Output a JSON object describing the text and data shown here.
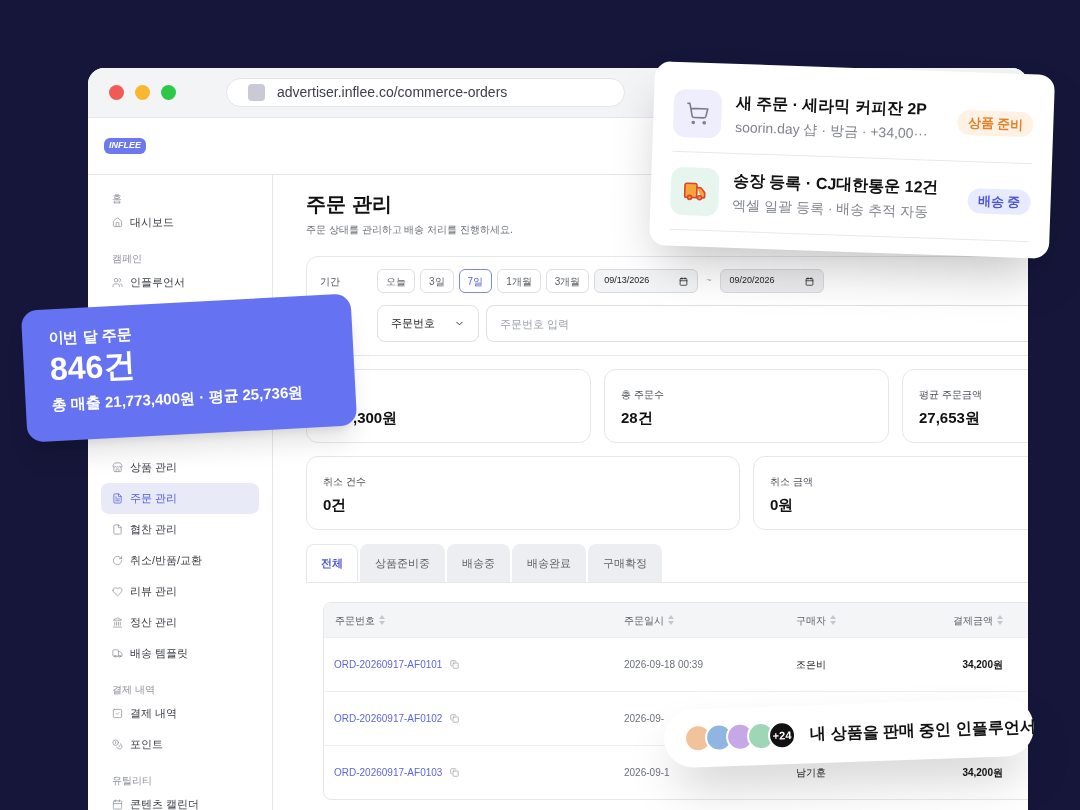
{
  "browser": {
    "url": "advertiser.inflee.co/commerce-orders"
  },
  "logo": "INFLEE",
  "sidebar": [
    {
      "heading": "홈",
      "items": [
        {
          "label": "대시보드",
          "selected": false
        }
      ]
    },
    {
      "heading": "캠페인",
      "items": [
        {
          "label": "인플루언서",
          "selected": false
        }
      ]
    },
    {
      "items": [
        {
          "label": "상품 관리",
          "selected": false
        },
        {
          "label": "주문 관리",
          "selected": true
        },
        {
          "label": "협찬 관리",
          "selected": false
        },
        {
          "label": "취소/반품/교환",
          "selected": false
        },
        {
          "label": "리뷰 관리",
          "selected": false
        },
        {
          "label": "정산 관리",
          "selected": false
        },
        {
          "label": "배송 템플릿",
          "selected": false
        }
      ]
    },
    {
      "heading": "결제 내역",
      "items": [
        {
          "label": "결제 내역",
          "selected": false
        },
        {
          "label": "포인트",
          "selected": false
        }
      ]
    },
    {
      "heading": "유틸리티",
      "items": [
        {
          "label": "콘텐츠 캘린더",
          "selected": false
        }
      ]
    }
  ],
  "page": {
    "title": "주문 관리",
    "subtitle": "주문 상태를 관리하고 배송 처리를 진행하세요."
  },
  "filter": {
    "period_label": "기간",
    "presets": [
      {
        "label": "오늘",
        "selected": false
      },
      {
        "label": "3일",
        "selected": false
      },
      {
        "label": "7일",
        "selected": true
      },
      {
        "label": "1개월",
        "selected": false
      },
      {
        "label": "3개월",
        "selected": false
      }
    ],
    "date_from": "09/13/2026",
    "separator": "~",
    "date_to": "09/20/2026",
    "search_type": "주문번호",
    "search_placeholder": "주문번호 입력"
  },
  "stats": [
    [
      {
        "value": ",300원"
      },
      {
        "label": "총 주문수",
        "value": "28건"
      },
      {
        "label": "평균 주문금액",
        "value": "27,653원"
      }
    ],
    [
      {
        "label": "취소 건수",
        "value": "0건"
      },
      {
        "label": "취소 금액",
        "value": "0원"
      }
    ]
  ],
  "tabs": [
    {
      "label": "전체",
      "selected": true
    },
    {
      "label": "상품준비중",
      "selected": false
    },
    {
      "label": "배송중",
      "selected": false
    },
    {
      "label": "배송완료",
      "selected": false
    },
    {
      "label": "구매확정",
      "selected": false
    }
  ],
  "table": {
    "columns": [
      "주문번호",
      "주문일시",
      "구매자",
      "결제금액"
    ],
    "rows": [
      {
        "order_no": "ORD-20260917-AF0101",
        "date": "2026-09-18 00:39",
        "buyer": "조은비",
        "amount": "34,200원"
      },
      {
        "order_no": "ORD-20260917-AF0102",
        "date": "2026-09-"
      },
      {
        "order_no": "ORD-20260917-AF0103",
        "date": "2026-09-1",
        "buyer": "남기훈",
        "amount": "34,200원"
      }
    ]
  },
  "notifications": [
    {
      "kind": "order",
      "title": "새 주문 · 세라믹 커피잔 2P",
      "subtitle": "soorin.day 샵 · 방금 · +34,00···",
      "badge": "상품 준비"
    },
    {
      "kind": "shipping",
      "title": "송장 등록 · CJ대한통운 12건",
      "subtitle": "엑셀 일괄 등록 · 배송 추적 자동",
      "badge": "배송 중"
    }
  ],
  "summary_card": {
    "label": "이번 달 주문",
    "value": "846건",
    "detail": "총 매출 21,773,400원 · 평균 25,736원"
  },
  "influencers": {
    "avatars": [
      {
        "color": "#f2c29b"
      },
      {
        "color": "#8fb6e0"
      },
      {
        "color": "#c6a8e8"
      },
      {
        "color": "#9fd6b5"
      }
    ],
    "more": "+24",
    "caption": "내 상품을 판매 중인 인플루언서"
  }
}
